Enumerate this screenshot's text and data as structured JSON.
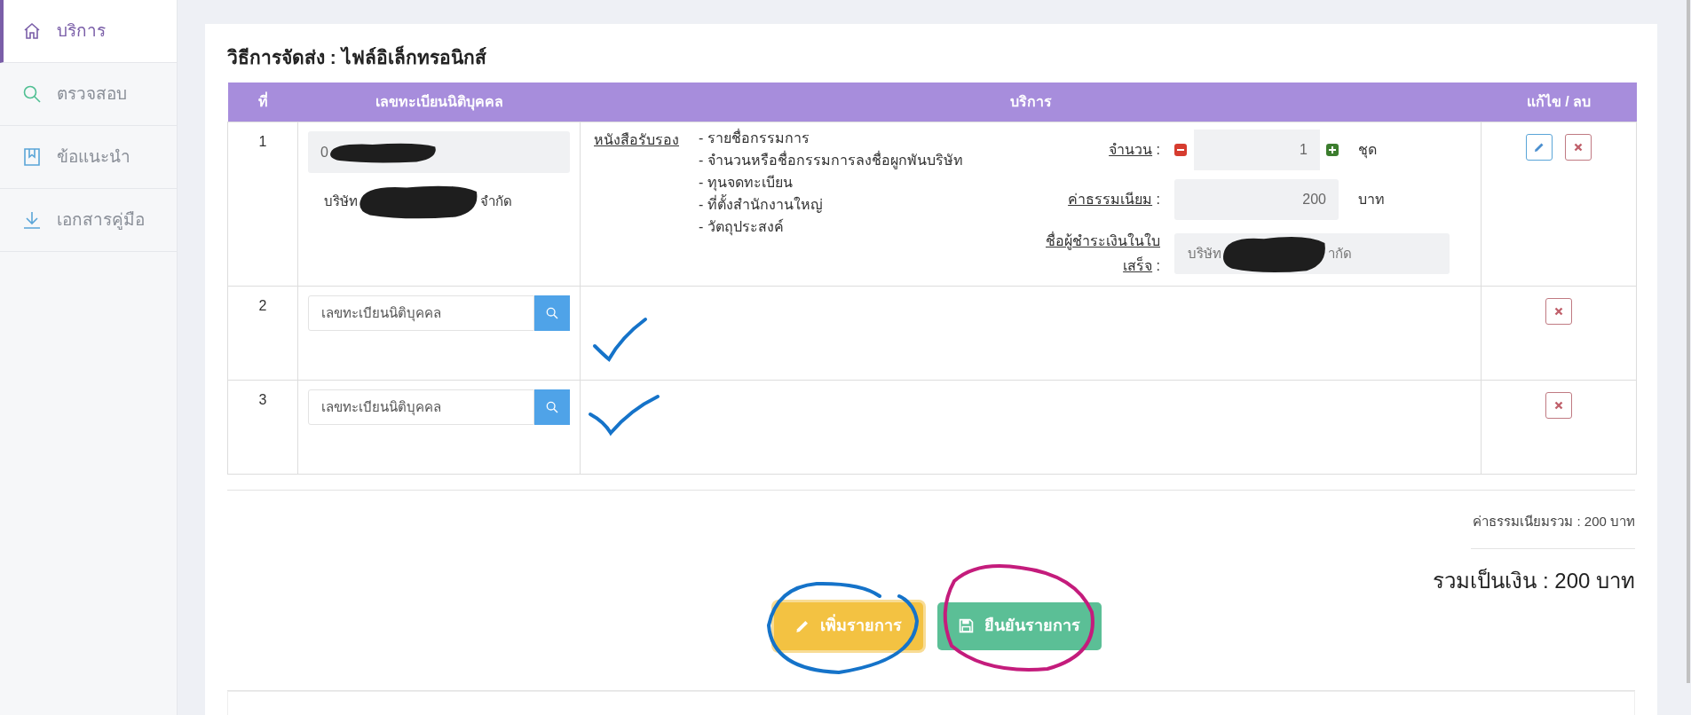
{
  "sidebar": {
    "items": [
      {
        "label": "บริการ",
        "selected": true
      },
      {
        "label": "ตรวจสอบ",
        "selected": false
      },
      {
        "label": "ข้อแนะนำ",
        "selected": false
      },
      {
        "label": "เอกสารคู่มือ",
        "selected": false
      }
    ]
  },
  "title": "วิธีการจัดส่ง : ไฟล์อิเล็กทรอนิกส์",
  "table": {
    "columns": [
      "ที่",
      "เลขทะเบียนนิติบุคคล",
      "บริการ",
      "แก้ไข / ลบ"
    ],
    "rows": [
      {
        "number": "1",
        "kind": "filled",
        "registration_value": "0",
        "company_parts": [
          "บริษัท",
          "จำกัด"
        ],
        "service_link": "หนังสือรับรอง",
        "service_items": [
          "- รายชื่อกรรมการ",
          "- จำนวนหรือชื่อกรรมการลงชื่อผูกพันบริษัท",
          "- ทุนจดทะเบียน",
          "- ที่ตั้งสำนักงานใหญ่",
          "- วัตถุประสงค์"
        ],
        "fields": [
          {
            "kind": "quantity",
            "label": "จำนวน",
            "colon": ":",
            "value": "1",
            "unit": "ชุด"
          },
          {
            "kind": "fee",
            "label": "ค่าธรรมเนียม",
            "colon": ":",
            "value": "200",
            "unit": "บาท"
          },
          {
            "kind": "payer",
            "label": "ชื่อผู้ชำระเงินในใบเสร็จ",
            "colon": ":",
            "value_parts": [
              "บริษัท",
              "ากัด"
            ]
          }
        ],
        "actions": [
          {
            "kind": "edit"
          },
          {
            "kind": "delete"
          }
        ]
      },
      {
        "number": "2",
        "kind": "search",
        "placeholder": "เลขทะเบียนนิติบุคคล",
        "actions": [
          {
            "kind": "delete"
          }
        ]
      },
      {
        "number": "3",
        "kind": "search",
        "placeholder": "เลขทะเบียนนิติบุคคล",
        "actions": [
          {
            "kind": "delete"
          }
        ]
      }
    ]
  },
  "fee_total": "ค่าธรรมเนียมรวม : 200 บาท",
  "grand_total": "รวมเป็นเงิน : 200 บาท",
  "buttons": [
    {
      "label": "เพิ่มรายการ",
      "kind": "add"
    },
    {
      "label": "ยืนยันรายการ",
      "kind": "confirm"
    }
  ]
}
